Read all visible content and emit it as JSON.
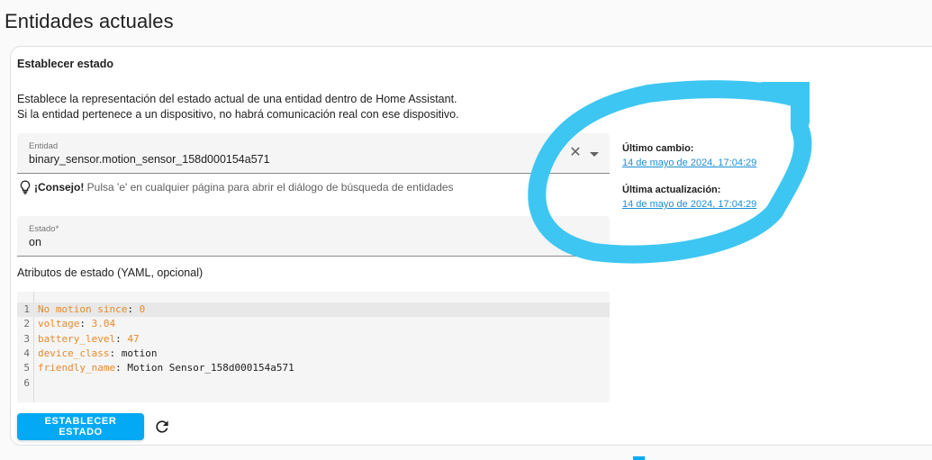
{
  "page": {
    "title": "Entidades actuales"
  },
  "card": {
    "title": "Establecer estado",
    "description_line1": "Establece la representación del estado actual de una entidad dentro de Home Assistant.",
    "description_line2": "Si la entidad pertenece a un dispositivo, no habrá comunicación real con ese dispositivo."
  },
  "entity_field": {
    "label": "Entidad",
    "value": "binary_sensor.motion_sensor_158d000154a571"
  },
  "tip": {
    "bold": "¡Consejo!",
    "text": " Pulsa 'e' en cualquier página para abrir el diálogo de búsqueda de entidades"
  },
  "state_field": {
    "label": "Estado*",
    "value": "on"
  },
  "attributes": {
    "label": "Atributos de estado (YAML, opcional)",
    "lines": [
      {
        "num": "1",
        "key": "No motion since",
        "sep": ": ",
        "value": "0",
        "value_numeric": true
      },
      {
        "num": "2",
        "key": "voltage",
        "sep": ": ",
        "value": "3.04",
        "value_numeric": true
      },
      {
        "num": "3",
        "key": "battery_level",
        "sep": ": ",
        "value": "47",
        "value_numeric": true
      },
      {
        "num": "4",
        "key": "device_class",
        "sep": ": ",
        "value": "motion",
        "value_numeric": false
      },
      {
        "num": "5",
        "key": "friendly_name",
        "sep": ": ",
        "value": "Motion Sensor_158d000154a571",
        "value_numeric": false
      },
      {
        "num": "6",
        "key": "",
        "sep": "",
        "value": "",
        "value_numeric": false
      }
    ]
  },
  "actions": {
    "set_state_label": "ESTABLECER ESTADO",
    "refresh_icon": "refresh-icon"
  },
  "meta": {
    "last_changed_label": "Último cambio:",
    "last_changed_value": "14 de mayo de 2024, 17:04:29",
    "last_updated_label": "Última actualización:",
    "last_updated_value": "14 de mayo de 2024, 17:04:29"
  },
  "colors": {
    "primary": "#03a9f4",
    "link": "#1a8fd6",
    "highlight_scribble": "#3ec6f2",
    "yaml_key": "#e6892d"
  }
}
